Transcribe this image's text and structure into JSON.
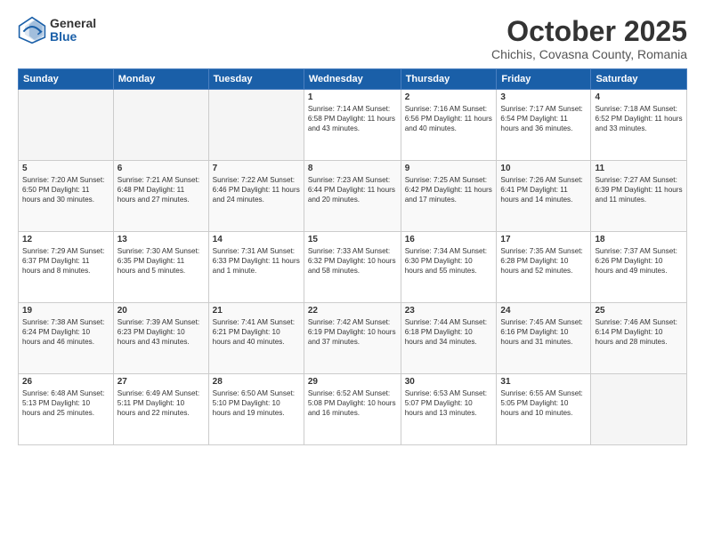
{
  "header": {
    "logo_general": "General",
    "logo_blue": "Blue",
    "month": "October 2025",
    "location": "Chichis, Covasna County, Romania"
  },
  "weekdays": [
    "Sunday",
    "Monday",
    "Tuesday",
    "Wednesday",
    "Thursday",
    "Friday",
    "Saturday"
  ],
  "weeks": [
    [
      {
        "day": "",
        "content": ""
      },
      {
        "day": "",
        "content": ""
      },
      {
        "day": "",
        "content": ""
      },
      {
        "day": "1",
        "content": "Sunrise: 7:14 AM\nSunset: 6:58 PM\nDaylight: 11 hours\nand 43 minutes."
      },
      {
        "day": "2",
        "content": "Sunrise: 7:16 AM\nSunset: 6:56 PM\nDaylight: 11 hours\nand 40 minutes."
      },
      {
        "day": "3",
        "content": "Sunrise: 7:17 AM\nSunset: 6:54 PM\nDaylight: 11 hours\nand 36 minutes."
      },
      {
        "day": "4",
        "content": "Sunrise: 7:18 AM\nSunset: 6:52 PM\nDaylight: 11 hours\nand 33 minutes."
      }
    ],
    [
      {
        "day": "5",
        "content": "Sunrise: 7:20 AM\nSunset: 6:50 PM\nDaylight: 11 hours\nand 30 minutes."
      },
      {
        "day": "6",
        "content": "Sunrise: 7:21 AM\nSunset: 6:48 PM\nDaylight: 11 hours\nand 27 minutes."
      },
      {
        "day": "7",
        "content": "Sunrise: 7:22 AM\nSunset: 6:46 PM\nDaylight: 11 hours\nand 24 minutes."
      },
      {
        "day": "8",
        "content": "Sunrise: 7:23 AM\nSunset: 6:44 PM\nDaylight: 11 hours\nand 20 minutes."
      },
      {
        "day": "9",
        "content": "Sunrise: 7:25 AM\nSunset: 6:42 PM\nDaylight: 11 hours\nand 17 minutes."
      },
      {
        "day": "10",
        "content": "Sunrise: 7:26 AM\nSunset: 6:41 PM\nDaylight: 11 hours\nand 14 minutes."
      },
      {
        "day": "11",
        "content": "Sunrise: 7:27 AM\nSunset: 6:39 PM\nDaylight: 11 hours\nand 11 minutes."
      }
    ],
    [
      {
        "day": "12",
        "content": "Sunrise: 7:29 AM\nSunset: 6:37 PM\nDaylight: 11 hours\nand 8 minutes."
      },
      {
        "day": "13",
        "content": "Sunrise: 7:30 AM\nSunset: 6:35 PM\nDaylight: 11 hours\nand 5 minutes."
      },
      {
        "day": "14",
        "content": "Sunrise: 7:31 AM\nSunset: 6:33 PM\nDaylight: 11 hours\nand 1 minute."
      },
      {
        "day": "15",
        "content": "Sunrise: 7:33 AM\nSunset: 6:32 PM\nDaylight: 10 hours\nand 58 minutes."
      },
      {
        "day": "16",
        "content": "Sunrise: 7:34 AM\nSunset: 6:30 PM\nDaylight: 10 hours\nand 55 minutes."
      },
      {
        "day": "17",
        "content": "Sunrise: 7:35 AM\nSunset: 6:28 PM\nDaylight: 10 hours\nand 52 minutes."
      },
      {
        "day": "18",
        "content": "Sunrise: 7:37 AM\nSunset: 6:26 PM\nDaylight: 10 hours\nand 49 minutes."
      }
    ],
    [
      {
        "day": "19",
        "content": "Sunrise: 7:38 AM\nSunset: 6:24 PM\nDaylight: 10 hours\nand 46 minutes."
      },
      {
        "day": "20",
        "content": "Sunrise: 7:39 AM\nSunset: 6:23 PM\nDaylight: 10 hours\nand 43 minutes."
      },
      {
        "day": "21",
        "content": "Sunrise: 7:41 AM\nSunset: 6:21 PM\nDaylight: 10 hours\nand 40 minutes."
      },
      {
        "day": "22",
        "content": "Sunrise: 7:42 AM\nSunset: 6:19 PM\nDaylight: 10 hours\nand 37 minutes."
      },
      {
        "day": "23",
        "content": "Sunrise: 7:44 AM\nSunset: 6:18 PM\nDaylight: 10 hours\nand 34 minutes."
      },
      {
        "day": "24",
        "content": "Sunrise: 7:45 AM\nSunset: 6:16 PM\nDaylight: 10 hours\nand 31 minutes."
      },
      {
        "day": "25",
        "content": "Sunrise: 7:46 AM\nSunset: 6:14 PM\nDaylight: 10 hours\nand 28 minutes."
      }
    ],
    [
      {
        "day": "26",
        "content": "Sunrise: 6:48 AM\nSunset: 5:13 PM\nDaylight: 10 hours\nand 25 minutes."
      },
      {
        "day": "27",
        "content": "Sunrise: 6:49 AM\nSunset: 5:11 PM\nDaylight: 10 hours\nand 22 minutes."
      },
      {
        "day": "28",
        "content": "Sunrise: 6:50 AM\nSunset: 5:10 PM\nDaylight: 10 hours\nand 19 minutes."
      },
      {
        "day": "29",
        "content": "Sunrise: 6:52 AM\nSunset: 5:08 PM\nDaylight: 10 hours\nand 16 minutes."
      },
      {
        "day": "30",
        "content": "Sunrise: 6:53 AM\nSunset: 5:07 PM\nDaylight: 10 hours\nand 13 minutes."
      },
      {
        "day": "31",
        "content": "Sunrise: 6:55 AM\nSunset: 5:05 PM\nDaylight: 10 hours\nand 10 minutes."
      },
      {
        "day": "",
        "content": ""
      }
    ]
  ]
}
